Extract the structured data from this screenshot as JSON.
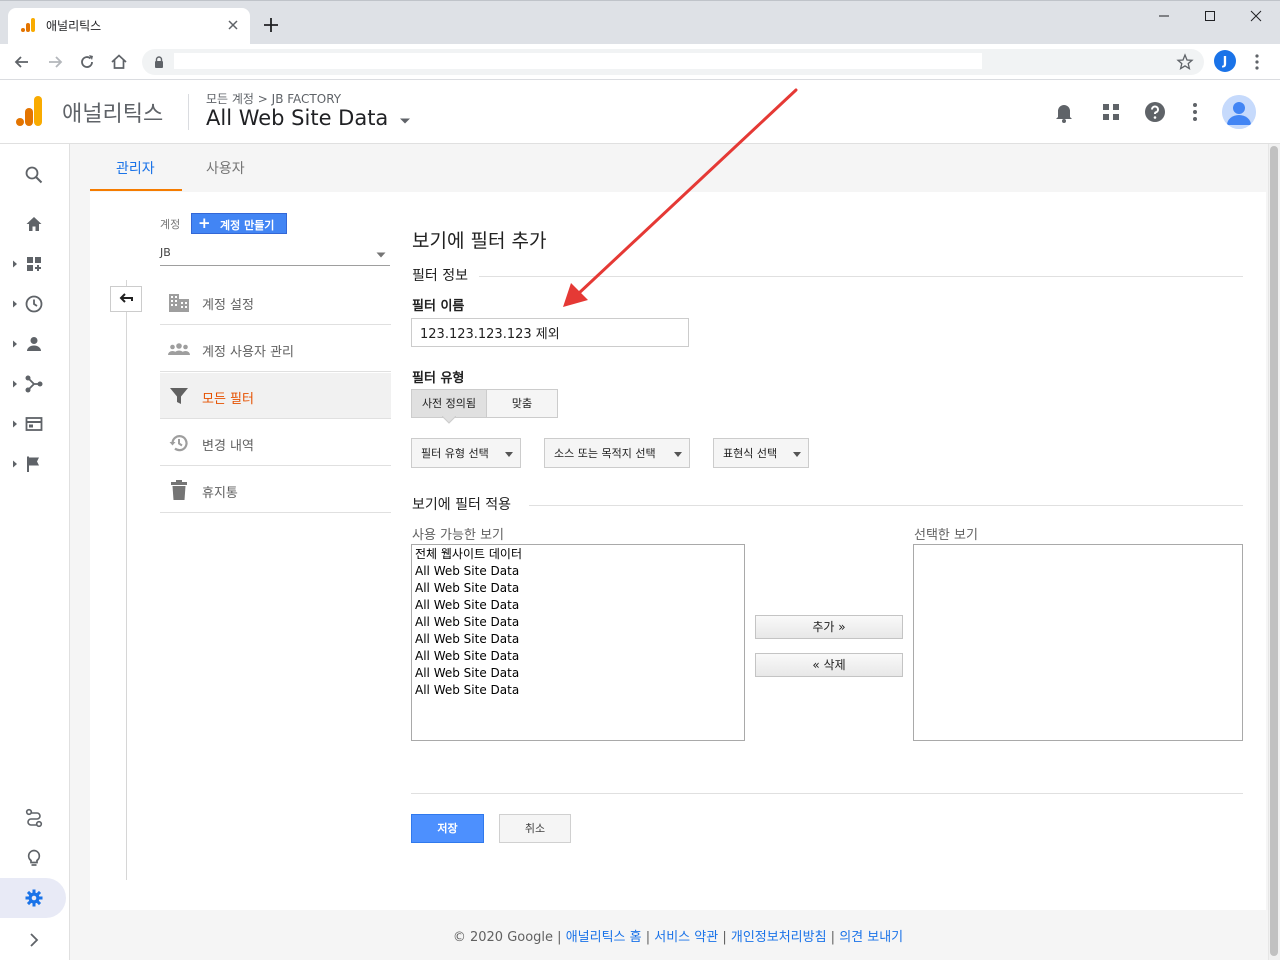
{
  "browser": {
    "tab_title": "애널리틱스",
    "profile_initial": "J"
  },
  "header": {
    "app_name": "애널리틱스",
    "breadcrumb": "모든 계정 > JB FACTORY",
    "view_name": "All Web Site Data"
  },
  "tabs": [
    {
      "label": "관리자",
      "active": true
    },
    {
      "label": "사용자",
      "active": false
    }
  ],
  "account": {
    "label": "계정",
    "create_button": "계정 만들기",
    "selected": "JB"
  },
  "menu": [
    {
      "label": "계정 설정",
      "icon": "building-icon"
    },
    {
      "label": "계정 사용자 관리",
      "icon": "people-icon"
    },
    {
      "label": "모든 필터",
      "icon": "filter-icon",
      "active": true
    },
    {
      "label": "변경 내역",
      "icon": "history-icon"
    },
    {
      "label": "휴지통",
      "icon": "trash-icon"
    }
  ],
  "form": {
    "title": "보기에 필터 추가",
    "section_info": "필터 정보",
    "filter_name_label": "필터 이름",
    "filter_name_value": "123.123.123.123 제외",
    "filter_type_label": "필터 유형",
    "type_predefined": "사전 정의됨",
    "type_custom": "맞춤",
    "dropdowns": [
      "필터 유형 선택",
      "소스 또는 목적지 선택",
      "표현식 선택"
    ],
    "section_apply": "보기에 필터 적용",
    "available_label": "사용 가능한 보기",
    "selected_label": "선택한 보기",
    "available_views": [
      "전체 웹사이트 데이터",
      "All Web Site Data",
      "All Web Site Data",
      "All Web Site Data",
      "All Web Site Data",
      "All Web Site Data",
      "All Web Site Data",
      "All Web Site Data",
      "All Web Site Data"
    ],
    "add_button": "추가 »",
    "remove_button": "« 삭제",
    "save_button": "저장",
    "cancel_button": "취소"
  },
  "footer": {
    "copyright": "© 2020 Google",
    "sep": " | ",
    "links": [
      "애널리틱스 홈",
      "서비스 약관",
      "개인정보처리방침",
      "의견 보내기"
    ]
  },
  "colors": {
    "accent_blue": "#1a73e8",
    "ga_orange": "#f57c00",
    "annotation_red": "#e53935"
  }
}
